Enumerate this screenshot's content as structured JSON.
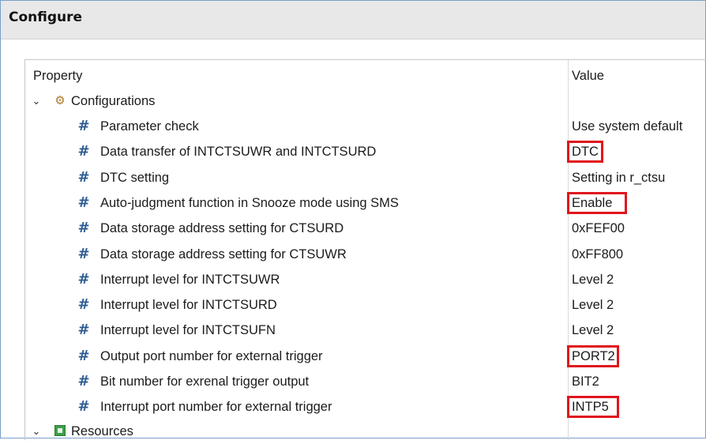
{
  "window": {
    "title": "Configure"
  },
  "table": {
    "headers": {
      "property": "Property",
      "value": "Value"
    },
    "groups": [
      {
        "label": "Configurations",
        "icon": "gear-icon",
        "expanded": true
      },
      {
        "label": "Resources",
        "icon": "resources-icon",
        "expanded": true
      }
    ],
    "rows": [
      {
        "property": "Parameter check",
        "value": "Use system default",
        "highlighted": false
      },
      {
        "property": "Data transfer of INTCTSUWR and INTCTSURD",
        "value": "DTC",
        "highlighted": true
      },
      {
        "property": "DTC setting",
        "value": "Setting in r_ctsu",
        "highlighted": false
      },
      {
        "property": "Auto-judgment function in Snooze mode using SMS",
        "value": "Enable",
        "highlighted": true
      },
      {
        "property": "Data storage address setting for CTSURD",
        "value": "0xFEF00",
        "highlighted": false
      },
      {
        "property": "Data storage address setting for CTSUWR",
        "value": "0xFF800",
        "highlighted": false
      },
      {
        "property": "Interrupt level for INTCTSUWR",
        "value": "Level 2",
        "highlighted": false
      },
      {
        "property": "Interrupt level for INTCTSURD",
        "value": "Level 2",
        "highlighted": false
      },
      {
        "property": "Interrupt level for INTCTSUFN",
        "value": "Level 2",
        "highlighted": false
      },
      {
        "property": "Output port number for external trigger",
        "value": "PORT2",
        "highlighted": true
      },
      {
        "property": "Bit number for exrenal trigger output",
        "value": "BIT2",
        "highlighted": false
      },
      {
        "property": "Interrupt port number for external trigger",
        "value": "INTP5",
        "highlighted": true
      }
    ]
  },
  "colors": {
    "highlight_border": "#e0151c",
    "hash_icon": "#2f5d93",
    "title_bar": "#e8e8e8"
  }
}
